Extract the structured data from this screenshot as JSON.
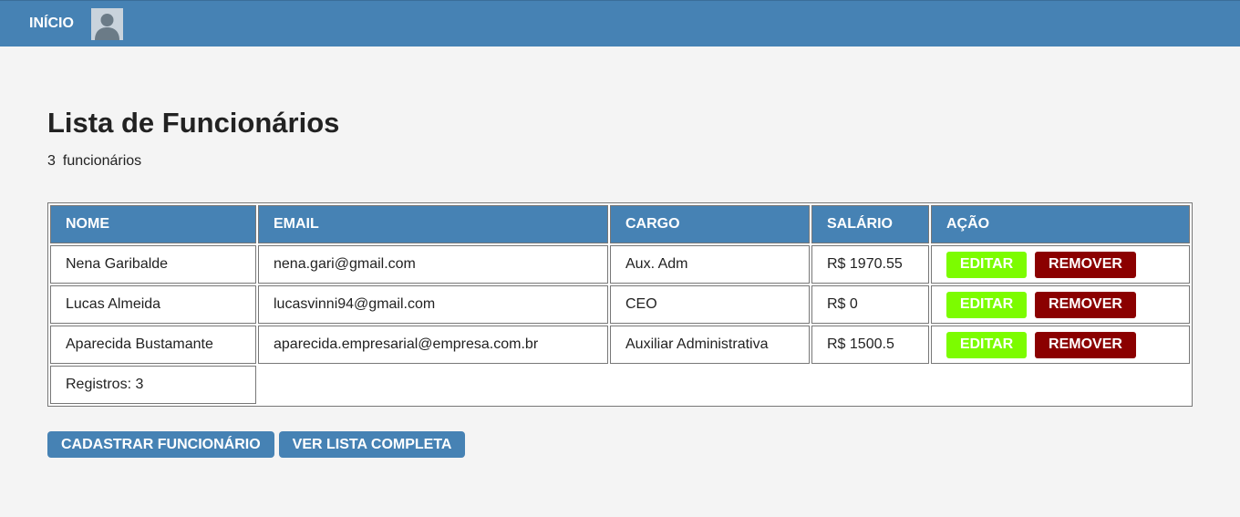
{
  "nav": {
    "home_label": "INÍCIO",
    "avatar_icon": "user-avatar-icon"
  },
  "page": {
    "title": "Lista de Funcionários",
    "count_value": "3",
    "count_label": "funcionários"
  },
  "table": {
    "headers": [
      "NOME",
      "EMAIL",
      "CARGO",
      "SALÁRIO",
      "AÇÃO"
    ],
    "rows": [
      {
        "nome": "Nena Garibalde",
        "email": "nena.gari@gmail.com",
        "cargo": "Aux. Adm",
        "salario": "R$ 1970.55"
      },
      {
        "nome": "Lucas Almeida",
        "email": "lucasvinni94@gmail.com",
        "cargo": "CEO",
        "salario": "R$ 0"
      },
      {
        "nome": "Aparecida Bustamante",
        "email": "aparecida.empresarial@empresa.com.br",
        "cargo": "Auxiliar Administrativa",
        "salario": "R$ 1500.5"
      }
    ],
    "edit_label": "EDITAR",
    "remove_label": "REMOVER",
    "footer": "Registros: 3"
  },
  "actions": {
    "register_label": "CADASTRAR FUNCIONÁRIO",
    "full_list_label": "VER LISTA COMPLETA"
  },
  "colors": {
    "primary": "#4682b4",
    "edit": "#7cfc00",
    "remove": "#8b0000"
  }
}
